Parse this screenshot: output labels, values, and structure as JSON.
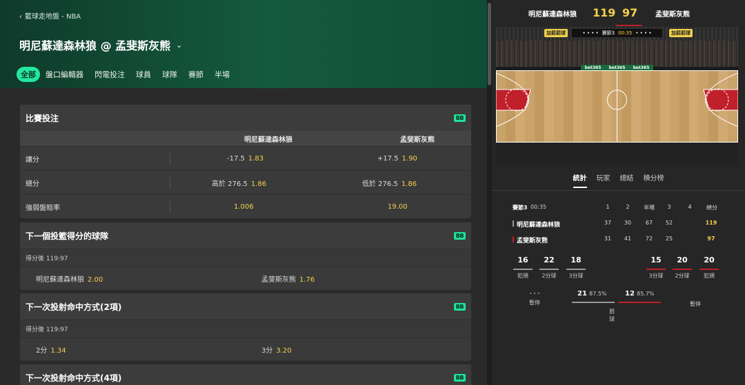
{
  "breadcrumb": "籃球走地盤 - NBA",
  "match_title": "明尼蘇達森林狼 @ 孟斐斯灰熊",
  "tabs": [
    "全部",
    "盤口編輯器",
    "閃電投注",
    "球員",
    "球隊",
    "賽節",
    "半場"
  ],
  "badge": "BB",
  "markets": {
    "m1": {
      "title": "比賽投注",
      "team1": "明尼蘇達森林狼",
      "team2": "孟斐斯灰熊",
      "rows": [
        {
          "label": "讓分",
          "l_line": "-17.5",
          "l_odd": "1.83",
          "r_line": "+17.5",
          "r_odd": "1.90"
        },
        {
          "label": "總分",
          "l_line": "高於 276.5",
          "l_odd": "1.86",
          "r_line": "低於 276.5",
          "r_odd": "1.86"
        },
        {
          "label": "強弱盤賠率",
          "l_line": "",
          "l_odd": "1.006",
          "r_line": "",
          "r_odd": "19.00"
        }
      ]
    },
    "m2": {
      "title": "下一個投籃得分的球隊",
      "sub": "得分後 119:97",
      "l_label": "明尼蘇達森林狼",
      "l_odd": "2.00",
      "r_label": "孟斐斯灰熊",
      "r_odd": "1.76"
    },
    "m3": {
      "title": "下一次投射命中方式(2項)",
      "sub": "得分後 119:97",
      "l_label": "2分",
      "l_odd": "1.34",
      "r_label": "3分",
      "r_odd": "3.20"
    },
    "m4": {
      "title": "下一次投射命中方式(4項)"
    }
  },
  "scoreboard": {
    "team1": "明尼蘇達森林狼",
    "team2": "孟斐斯灰熊",
    "score1": "119",
    "score2": "97",
    "bonus": "加罰罰球",
    "period": "賽節3",
    "clock": "00:35",
    "sponsor": "bet365"
  },
  "stat_tabs": [
    "統計",
    "玩家",
    "總結",
    "積分榜"
  ],
  "table": {
    "period_label": "賽節3",
    "clock": "00:35",
    "headers": [
      "1",
      "2",
      "半場",
      "3",
      "4",
      "總分"
    ],
    "rows": [
      {
        "team": "明尼蘇達森林狼",
        "q1": "37",
        "q2": "30",
        "half": "67",
        "q3": "52",
        "q4": "",
        "total": "119",
        "color": "#9a9a9a"
      },
      {
        "team": "孟斐斯灰熊",
        "q1": "31",
        "q2": "41",
        "half": "72",
        "q3": "25",
        "q4": "",
        "total": "97",
        "color": "#c0202a"
      }
    ]
  },
  "stats": {
    "left": [
      {
        "value": "16",
        "label": "犯規"
      },
      {
        "value": "22",
        "label": "2分球"
      },
      {
        "value": "18",
        "label": "3分球"
      }
    ],
    "right": [
      {
        "value": "15",
        "label": "3分球"
      },
      {
        "value": "20",
        "label": "2分球"
      },
      {
        "value": "20",
        "label": "犯規"
      }
    ],
    "timeout_label": "暫停",
    "ft_label": "罰球",
    "ft1": "21",
    "ft1_pct": "87.5%",
    "ft2": "12",
    "ft2_pct": "85.7%",
    "team1_color": "#9a9a9a",
    "team2_color": "#c0202a"
  }
}
